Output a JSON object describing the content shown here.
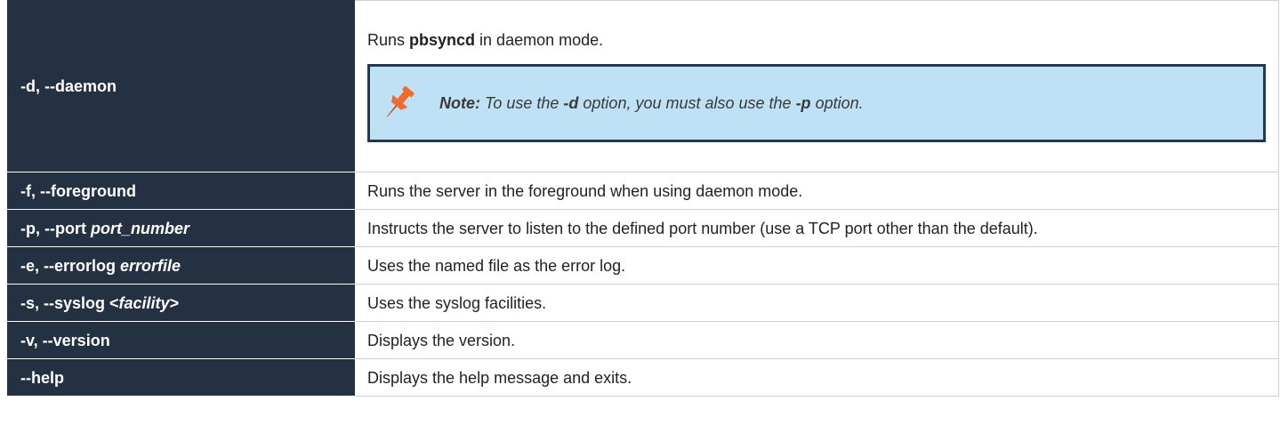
{
  "rows": [
    {
      "option": "-d, --daemon",
      "desc_pre": "Runs ",
      "desc_bold": "pbsyncd",
      "desc_post": " in daemon mode.",
      "note": {
        "label": "Note:",
        "pre": " To use the ",
        "opt1": "-d",
        "mid": " option, you must also use the ",
        "opt2": "-p",
        "post": " option.",
        "icon": "pushpin-icon",
        "icon_color": "#f26a2e"
      }
    },
    {
      "option": "-f, --foreground",
      "description": "Runs the server in the foreground when using daemon mode."
    },
    {
      "option": "-p, --port ",
      "option_arg": "port_number",
      "description": "Instructs the server to listen to the defined port number (use a TCP port other than the default)."
    },
    {
      "option": "-e, --errorlog ",
      "option_arg": "errorfile",
      "description": "Uses the named file as the error log."
    },
    {
      "option": "-s, --syslog <",
      "option_arg": "facility",
      "option_post": ">",
      "description": "Uses the syslog facilities."
    },
    {
      "option": "-v, --version",
      "description": "Displays the version."
    },
    {
      "option": "--help",
      "description": "Displays the help message and exits."
    }
  ],
  "colors": {
    "header_bg": "#243142",
    "note_bg": "#bfe1f6",
    "note_border": "#26384c"
  }
}
